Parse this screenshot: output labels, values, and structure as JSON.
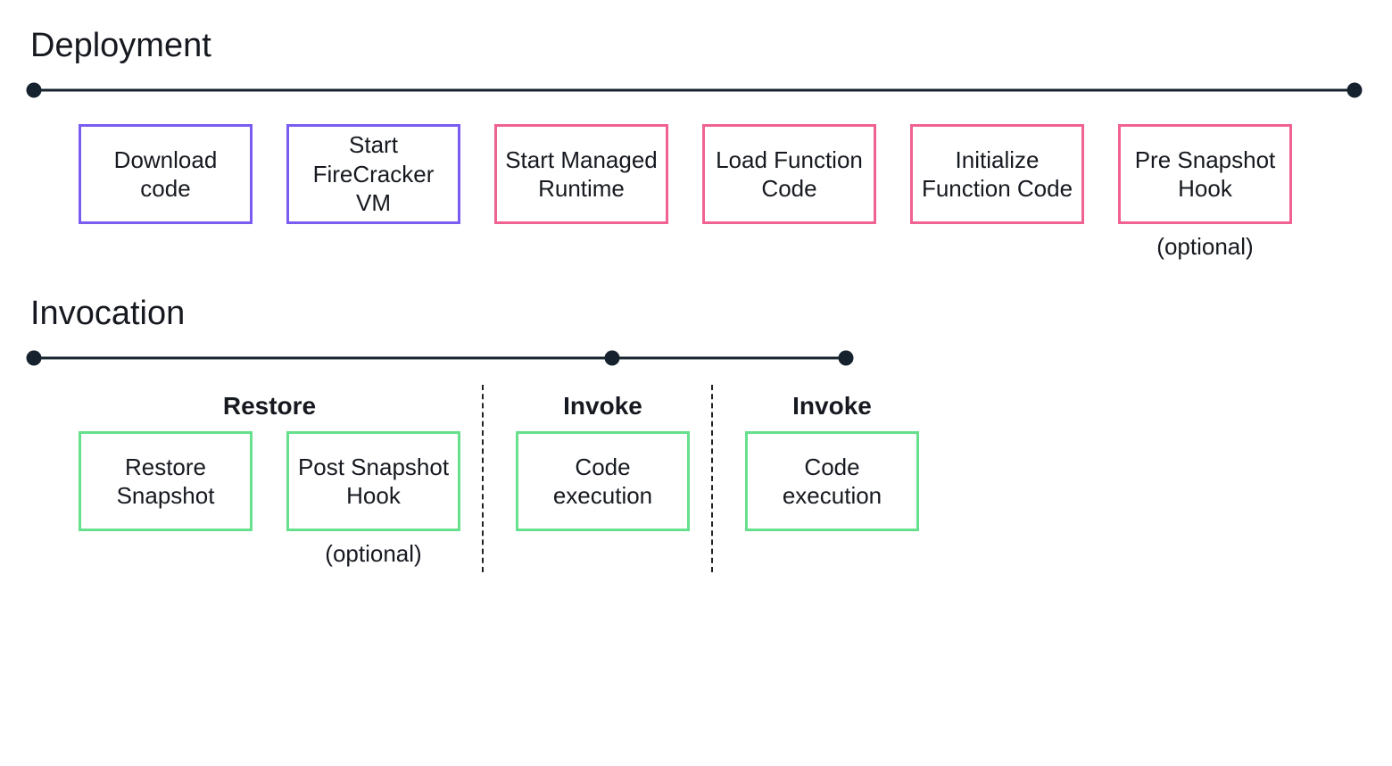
{
  "deployment": {
    "title": "Deployment",
    "boxes": [
      {
        "label": "Download code",
        "color": "purple"
      },
      {
        "label": "Start FireCracker VM",
        "color": "purple"
      },
      {
        "label": "Start Managed Runtime",
        "color": "pink"
      },
      {
        "label": "Load Function Code",
        "color": "pink"
      },
      {
        "label": "Initialize Function Code",
        "color": "pink"
      },
      {
        "label": "Pre Snapshot Hook",
        "color": "pink",
        "caption": "(optional)"
      }
    ]
  },
  "invocation": {
    "title": "Invocation",
    "groups": [
      {
        "label": "Restore",
        "boxes": [
          {
            "label": "Restore Snapshot",
            "color": "green"
          },
          {
            "label": "Post Snapshot Hook",
            "color": "green",
            "caption": "(optional)"
          }
        ]
      },
      {
        "label": "Invoke",
        "boxes": [
          {
            "label": "Code execution",
            "color": "green"
          }
        ]
      },
      {
        "label": "Invoke",
        "boxes": [
          {
            "label": "Code execution",
            "color": "green"
          }
        ]
      }
    ]
  }
}
